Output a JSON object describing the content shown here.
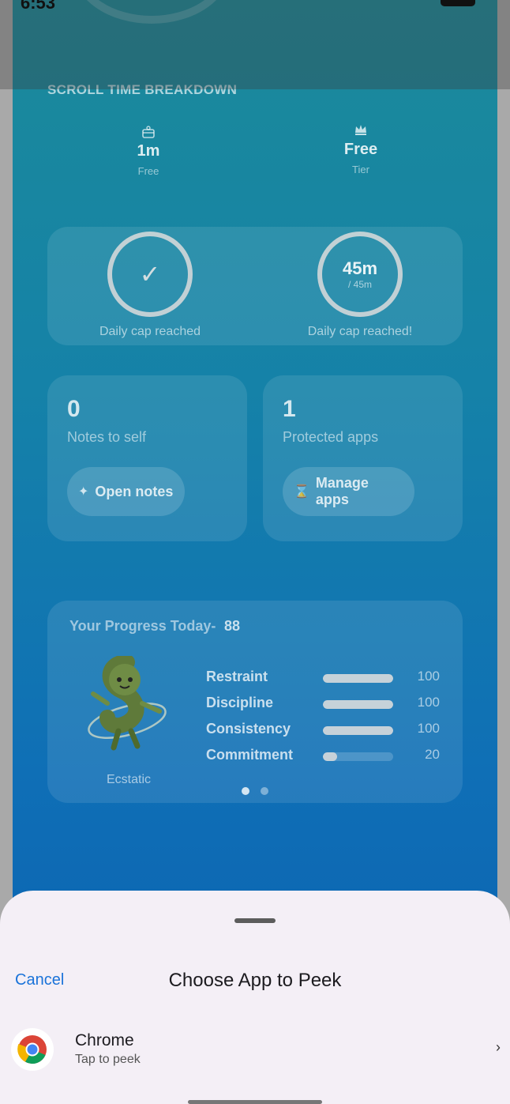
{
  "status_bar": {
    "time": "6:53"
  },
  "section_title": "SCROLL TIME BREAKDOWN",
  "stats": [
    {
      "icon": "gift-icon",
      "value": "1m",
      "label": "Free"
    },
    {
      "icon": "crown-icon",
      "value": "Free",
      "label": "Tier"
    }
  ],
  "caps": {
    "left": {
      "label": "Daily cap reached"
    },
    "right": {
      "value": "45m",
      "limit": "/ 45m",
      "label": "Daily cap reached!"
    }
  },
  "notes_card": {
    "count": "0",
    "label": "Notes to self",
    "button": "Open notes"
  },
  "apps_card": {
    "count": "1",
    "label": "Protected apps",
    "button": "Manage apps"
  },
  "progress": {
    "title": "Your Progress Today-",
    "score": "88",
    "mood": "Ecstatic",
    "metrics": [
      {
        "name": "Restraint",
        "value": "100",
        "fraction": 1.0
      },
      {
        "name": "Discipline",
        "value": "100",
        "fraction": 1.0
      },
      {
        "name": "Consistency",
        "value": "100",
        "fraction": 1.0
      },
      {
        "name": "Commitment",
        "value": "20",
        "fraction": 0.2
      }
    ],
    "page_count": 2,
    "active_page": 0
  },
  "sheet": {
    "cancel": "Cancel",
    "title": "Choose App to Peek",
    "apps": [
      {
        "name": "Chrome",
        "subtitle": "Tap to peek",
        "icon": "chrome-icon"
      }
    ]
  },
  "colors": {
    "accent": "#1a73d9",
    "sheet_bg": "#f4eff6",
    "gradient_top": "#1b8a9a",
    "gradient_bottom": "#0a5fb0"
  }
}
